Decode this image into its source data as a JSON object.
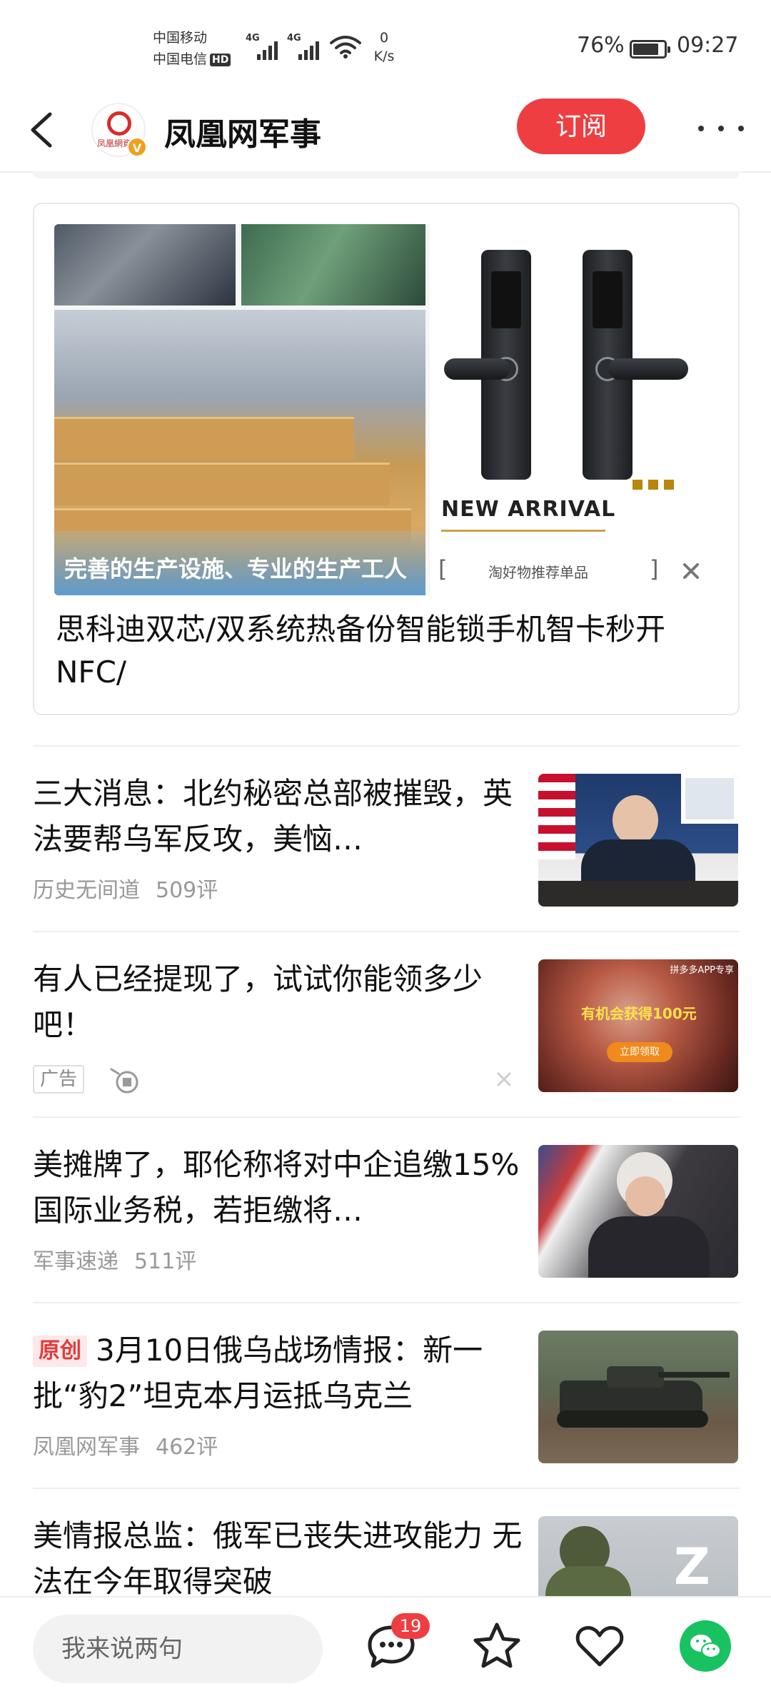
{
  "status_bar": {
    "carrier_1": "中国移动",
    "carrier_2": "中国电信",
    "hd_badge": "HD",
    "signal_1": "4G",
    "signal_2": "4G",
    "speed_value": "0",
    "speed_unit": "K/s",
    "battery": "76%",
    "battery_level": 0.76,
    "time": "09:27"
  },
  "header": {
    "channel_name": "凤凰网军事",
    "subscribe_label": "订阅",
    "logo_text": "凤凰網資訊",
    "verified_badge": "V"
  },
  "ad_card": {
    "slogan": "完善的生产设施、专业的生产工人",
    "new_arrival": "NEW ARRIVAL",
    "bracket_left": "[",
    "bracket_right": "]",
    "recommend_label": "淘好物推荐单品",
    "title": "思科迪双芯/双系统热备份智能锁手机智卡秒开NFC/"
  },
  "news": [
    {
      "title": "三大消息：北约秘密总部被摧毁，英法要帮乌军反攻，美恼…",
      "source": "历史无间道",
      "comments": "509评"
    },
    {
      "title": "有人已经提现了，试试你能领多少吧！",
      "ad_label": "广告",
      "thumb_banner": "有机会获得100元",
      "thumb_cta": "立即领取",
      "thumb_corner": "拼多多APP专享"
    },
    {
      "title": "美摊牌了，耶伦称将对中企追缴15%国际业务税，若拒缴将…",
      "source": "军事速递",
      "comments": "511评"
    },
    {
      "tag": "原创",
      "title": "3月10日俄乌战场情报：新一批“豹2”坦克本月运抵乌克兰",
      "source": "凤凰网军事",
      "comments": "462评"
    },
    {
      "title": "美情报总监：俄军已丧失进攻能力 无法在今年取得突破"
    }
  ],
  "bottom_bar": {
    "comment_placeholder": "我来说两句",
    "comment_count": "19"
  },
  "colors": {
    "accent_red": "#ef3e42",
    "wechat_green": "#19c261",
    "meta_gray": "#999999"
  },
  "icons": [
    "back-arrow-icon",
    "more-dots-icon",
    "close-icon",
    "ad-choices-icon",
    "comment-bubble-icon",
    "star-icon",
    "heart-icon",
    "wechat-icon"
  ]
}
